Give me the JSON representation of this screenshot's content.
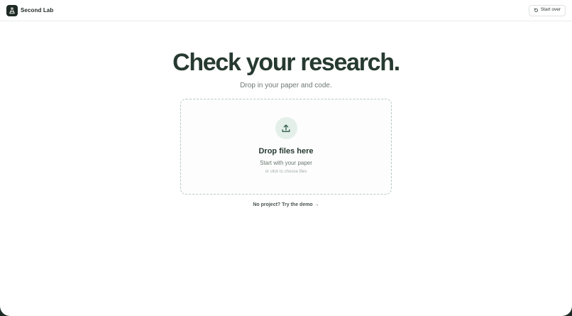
{
  "app": {
    "name": "Second Lab",
    "logo_icon": "flask-icon"
  },
  "header": {
    "start_over_label": "Start over",
    "start_over_icon": "refresh-icon"
  },
  "hero": {
    "title": "Check your research.",
    "subtitle": "Drop in your paper and code."
  },
  "dropzone": {
    "icon": "upload-icon",
    "title": "Drop files here",
    "subtitle": "Start with your paper",
    "hint": "or click to choose files"
  },
  "demo": {
    "label": "No project? Try the demo",
    "arrow": "→"
  },
  "colors": {
    "brand_dark": "#1f2a25",
    "accent_soft": "#e4efe9",
    "dashed_border": "#b9c9c1"
  }
}
